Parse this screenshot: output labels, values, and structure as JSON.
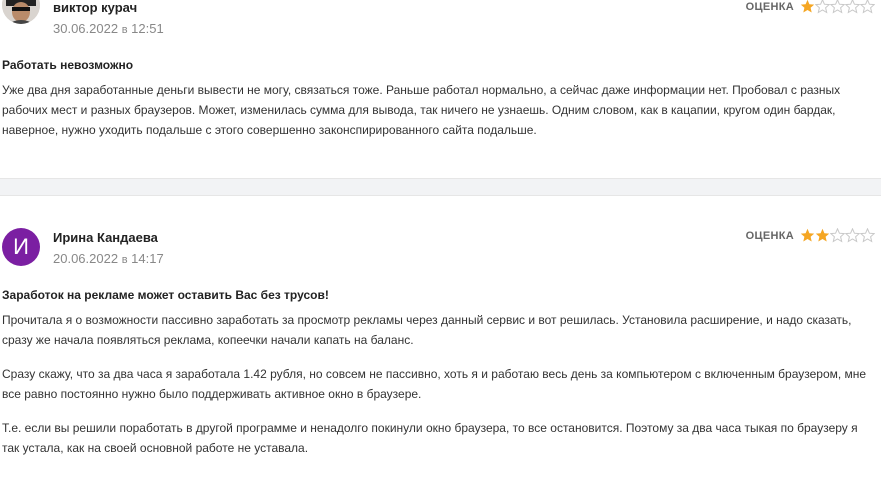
{
  "reviews": [
    {
      "author": "виктор курач",
      "date": "30.06.2022",
      "date_sep": "в",
      "time": "12:51",
      "rating_label": "ОЦЕНКА",
      "rating": 1,
      "rating_max": 5,
      "title": "Работать невозможно",
      "paragraphs": [
        "Уже два дня заработанные деньги вывести не могу, связаться тоже. Раньше работал нормально, а сейчас даже информации нет. Пробовал с разных рабочих мест и разных браузеров. Может, изменилась сумма для вывода, так ничего не узнаешь. Одним словом, как в кацапии, кругом один бардак, наверное, нужно уходить подальше с этого совершенно законспирированного сайта подальше."
      ]
    },
    {
      "author": "Ирина Кандаева",
      "avatar_letter": "И",
      "date": "20.06.2022",
      "date_sep": "в",
      "time": "14:17",
      "rating_label": "ОЦЕНКА",
      "rating": 2,
      "rating_max": 5,
      "title": "Заработок на рекламе может оставить Вас без трусов!",
      "paragraphs": [
        "Прочитала я о возможности пассивно заработать за просмотр рекламы через данный сервис и вот решилась. Установила расширение, и надо сказать, сразу же начала появляться реклама, копеечки начали капать на баланс.",
        "Сразу скажу, что за два часа я заработала 1.42 рубля, но совсем не пассивно, хоть я и работаю весь день за компьютером с включенным браузером, мне все равно постоянно нужно было поддерживать активное окно в браузере.",
        "Т.е. если вы решили поработать в другой программе и ненадолго покинули окно браузера, то все остановится. Поэтому за два часа тыкая по браузеру я так устала, как на своей основной работе не уставала."
      ]
    }
  ],
  "colors": {
    "star_filled": "#f5a623",
    "star_empty": "#c8c8c8",
    "avatar_bg": "#7b1fa2"
  }
}
